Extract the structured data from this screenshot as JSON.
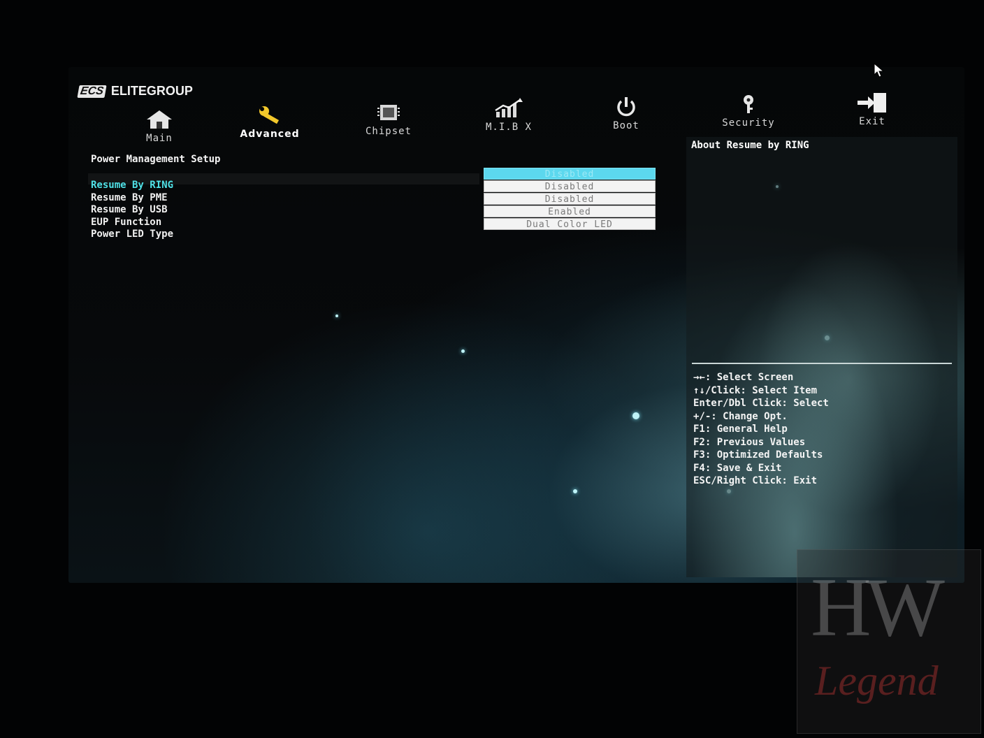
{
  "brand": {
    "mark": "ECS",
    "name": "ELITEGROUP"
  },
  "tabs": [
    {
      "label": "Main",
      "icon": "home-icon"
    },
    {
      "label": "Advanced",
      "icon": "wrench-icon",
      "active": true
    },
    {
      "label": "Chipset",
      "icon": "chip-icon"
    },
    {
      "label": "M.I.B X",
      "icon": "chart-up-icon"
    },
    {
      "label": "Boot",
      "icon": "power-icon"
    },
    {
      "label": "Security",
      "icon": "key-icon"
    },
    {
      "label": "Exit",
      "icon": "exit-door-icon"
    }
  ],
  "section_title": "Power Management Setup",
  "settings": [
    {
      "label": "Resume By RING",
      "value": "Disabled"
    },
    {
      "label": "Resume By PME",
      "value": "Disabled"
    },
    {
      "label": "Resume By USB",
      "value": "Disabled"
    },
    {
      "label": "EUP Function",
      "value": "Enabled"
    },
    {
      "label": "Power LED Type",
      "value": "Dual Color LED"
    }
  ],
  "help": {
    "title": "About Resume by RING",
    "keys": [
      "→←: Select Screen",
      "↑↓/Click: Select Item",
      "Enter/Dbl Click: Select",
      "+/-: Change Opt.",
      "F1: General Help",
      "F2: Previous Values",
      "F3: Optimized Defaults",
      "F4: Save & Exit",
      "ESC/Right Click: Exit"
    ]
  },
  "watermark": {
    "top": "HW",
    "bottom": "Legend"
  },
  "colors": {
    "accent": "#4fe0e6",
    "highlight_bar": "#5cd8ee",
    "text": "#f0f0f0"
  }
}
